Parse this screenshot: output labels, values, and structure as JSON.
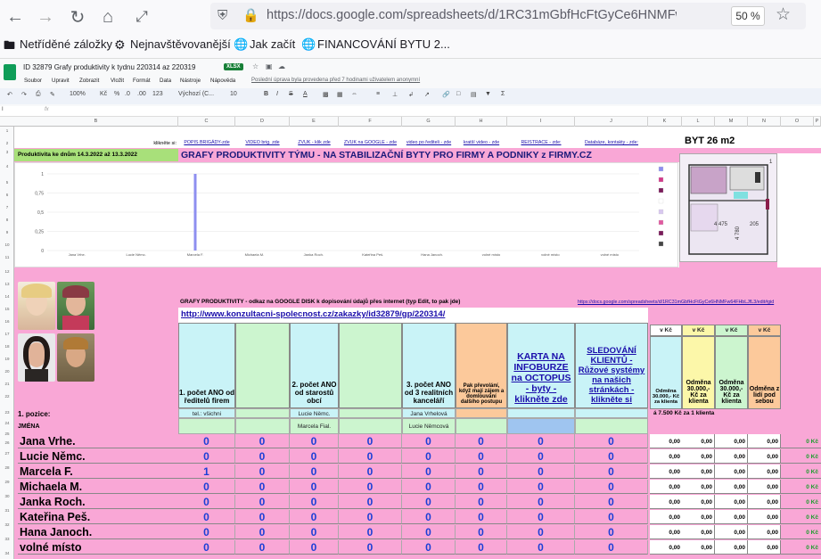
{
  "browser": {
    "url": "https://docs.google.com/spreadsheets/d/1RC31mGbfHcFtGyCe6HNMFw64FHblJfL3",
    "zoom": "50 %",
    "bookmarks": [
      "Netříděné záložky",
      "Nejnavštěvovanější",
      "Jak začít",
      "FINANCOVÁNÍ BYTU 2..."
    ]
  },
  "sheets": {
    "title": "ID 32879 Grafy produktivity k tydnu 220314 az 220319",
    "badge": "XLSX",
    "menu": [
      "Soubor",
      "Upravit",
      "Zobrazit",
      "Vložit",
      "Formát",
      "Data",
      "Nástroje",
      "Nápověda"
    ],
    "last_edit": "Poslední úprava byla provedena před 7 hodinami uživatelem anonymní",
    "toolbar": [
      "100%",
      "Kč",
      "%",
      ".0",
      ".00",
      "123",
      "Výchozí (C...",
      "10",
      "B",
      "I",
      "S",
      "A"
    ],
    "cell_ref": "I",
    "fx": "fx"
  },
  "columns": [
    "A",
    "B",
    "C",
    "D",
    "E",
    "F",
    "G",
    "H",
    "I",
    "J",
    "K",
    "L",
    "M",
    "N",
    "O",
    "P"
  ],
  "rows": [
    "1",
    "2",
    "3",
    "4",
    "5",
    "6",
    "7",
    "8",
    "9",
    "10",
    "11",
    "12",
    "13",
    "14",
    "15",
    "16",
    "17",
    "18",
    "19",
    "20",
    "21",
    "22",
    "23",
    "24",
    "25",
    "26",
    "27",
    "28",
    "29",
    "30",
    "31",
    "32",
    "33",
    "34"
  ],
  "links_row": {
    "prefix": "klikněte si:",
    "items": [
      "POPIS BRIGÁDY-zde",
      "VIDEO brig. zde",
      "ZVUK - klik zde",
      "ZVUK na GOOGLE - zde",
      "video po řediteli - zde",
      "kratší video - zde",
      "REISTRACE - zde:",
      "Databáze, kontakty - zde:"
    ]
  },
  "byt": "BYT 26 m2",
  "productivity_label": "Produktivita ke dnům 14.3.2022 až 13.3.2022",
  "banner": "GRAFY PRODUKTIVITY TÝMU - NA STABILIZAČNÍ BYTY PRO FIRMY A PODNIKY z FIRMY.CZ",
  "chart_data": {
    "type": "bar",
    "categories": [
      "Jana Vrhe.",
      "Lucie Němc.",
      "Marcela F.",
      "Michaela M.",
      "Janka Roch.",
      "Kateřina Peš.",
      "Hana Janoch.",
      "volné místo",
      "volné místo",
      "volné místo"
    ],
    "values": [
      0,
      0,
      1,
      0,
      0,
      0,
      0,
      0,
      0,
      0
    ],
    "yticks": [
      "1",
      "0,75",
      "0,5",
      "0,25",
      "0"
    ],
    "ylim": [
      0,
      1
    ],
    "bar_color": "#8e8ff0"
  },
  "floorplan": {
    "labels": [
      "4 475",
      "205",
      "4 780",
      "1"
    ]
  },
  "section": {
    "title": "GRAFY PRODUKTIVITY - odkaz na GOOGLE DISK k dopisování údajů přes internet (typ Edit, to pak jde)",
    "url": "http://www.konzultacni-spolecnost.cz/zakazky/id32879/gp/220314/",
    "right_url": "https://docs.google.com/spreadsheets/d/1RC31mGbfHcFtGyCe6HNMFw64FHbLJfL3/edit#gid"
  },
  "headers": {
    "c1": "1. počet ANO od ředitelů firem",
    "c3": "2. počet ANO od starostů obcí",
    "c5": "3. počet ANO od 3 realitních kanceláří",
    "c6": "Pak převolání, když mají zájem a domlouvání dalšího postupu",
    "c7": "KARTA NA INFOBURZE na OCTOPUS - byty - klikněte zde",
    "c8": "SLEDOVÁNÍ KLIENTŮ - Růžové systémy na našich stránkách - klikněte si",
    "m_head": [
      "v Kč",
      "v Kč",
      "v Kč",
      "v Kč"
    ],
    "m_body": [
      "Odměna 30.000,- Kč za klienta",
      "Odměna 30.000,- Kč za klienta",
      "Odměna 30.000,- Kč za klienta",
      "Odměna z lidí pod sebou"
    ]
  },
  "pozice": {
    "label": "1. pozice:",
    "c1": "tel.: všichni",
    "c3": "Lucie Němc.",
    "c5": "Jana Vrhelová",
    "money_note": "á 7.500 Kč za 1 klienta",
    "c3b": "Marcela Fial.",
    "c5b": "Lucie Němcová"
  },
  "jmena_label": "JMÉNA",
  "people": [
    {
      "name": "Jana Vrhe.",
      "vals": [
        "0",
        "0",
        "0",
        "0",
        "0",
        "0",
        "0",
        "0"
      ],
      "money": [
        "0,00",
        "0,00",
        "0,00",
        "0,00"
      ],
      "kc": "0 Kč"
    },
    {
      "name": "Lucie Němc.",
      "vals": [
        "0",
        "0",
        "0",
        "0",
        "0",
        "0",
        "0",
        "0"
      ],
      "money": [
        "0,00",
        "0,00",
        "0,00",
        "0,00"
      ],
      "kc": "0 Kč"
    },
    {
      "name": "Marcela F.",
      "vals": [
        "1",
        "0",
        "0",
        "0",
        "0",
        "0",
        "0",
        "0"
      ],
      "money": [
        "0,00",
        "0,00",
        "0,00",
        "0,00"
      ],
      "kc": "0 Kč"
    },
    {
      "name": "Michaela M.",
      "vals": [
        "0",
        "0",
        "0",
        "0",
        "0",
        "0",
        "0",
        "0"
      ],
      "money": [
        "0,00",
        "0,00",
        "0,00",
        "0,00"
      ],
      "kc": "0 Kč"
    },
    {
      "name": "Janka Roch.",
      "vals": [
        "0",
        "0",
        "0",
        "0",
        "0",
        "0",
        "0",
        "0"
      ],
      "money": [
        "0,00",
        "0,00",
        "0,00",
        "0,00"
      ],
      "kc": "0 Kč"
    },
    {
      "name": "Kateřina Peš.",
      "vals": [
        "0",
        "0",
        "0",
        "0",
        "0",
        "0",
        "0",
        "0"
      ],
      "money": [
        "0,00",
        "0,00",
        "0,00",
        "0,00"
      ],
      "kc": "0 Kč"
    },
    {
      "name": "Hana Janoch.",
      "vals": [
        "0",
        "0",
        "0",
        "0",
        "0",
        "0",
        "0",
        "0"
      ],
      "money": [
        "0,00",
        "0,00",
        "0,00",
        "0,00"
      ],
      "kc": "0 Kč"
    },
    {
      "name": "volné místo",
      "vals": [
        "0",
        "0",
        "0",
        "0",
        "0",
        "0",
        "0",
        "0"
      ],
      "money": [
        "0,00",
        "0,00",
        "0,00",
        "0,00"
      ],
      "kc": "0 Kč"
    }
  ]
}
